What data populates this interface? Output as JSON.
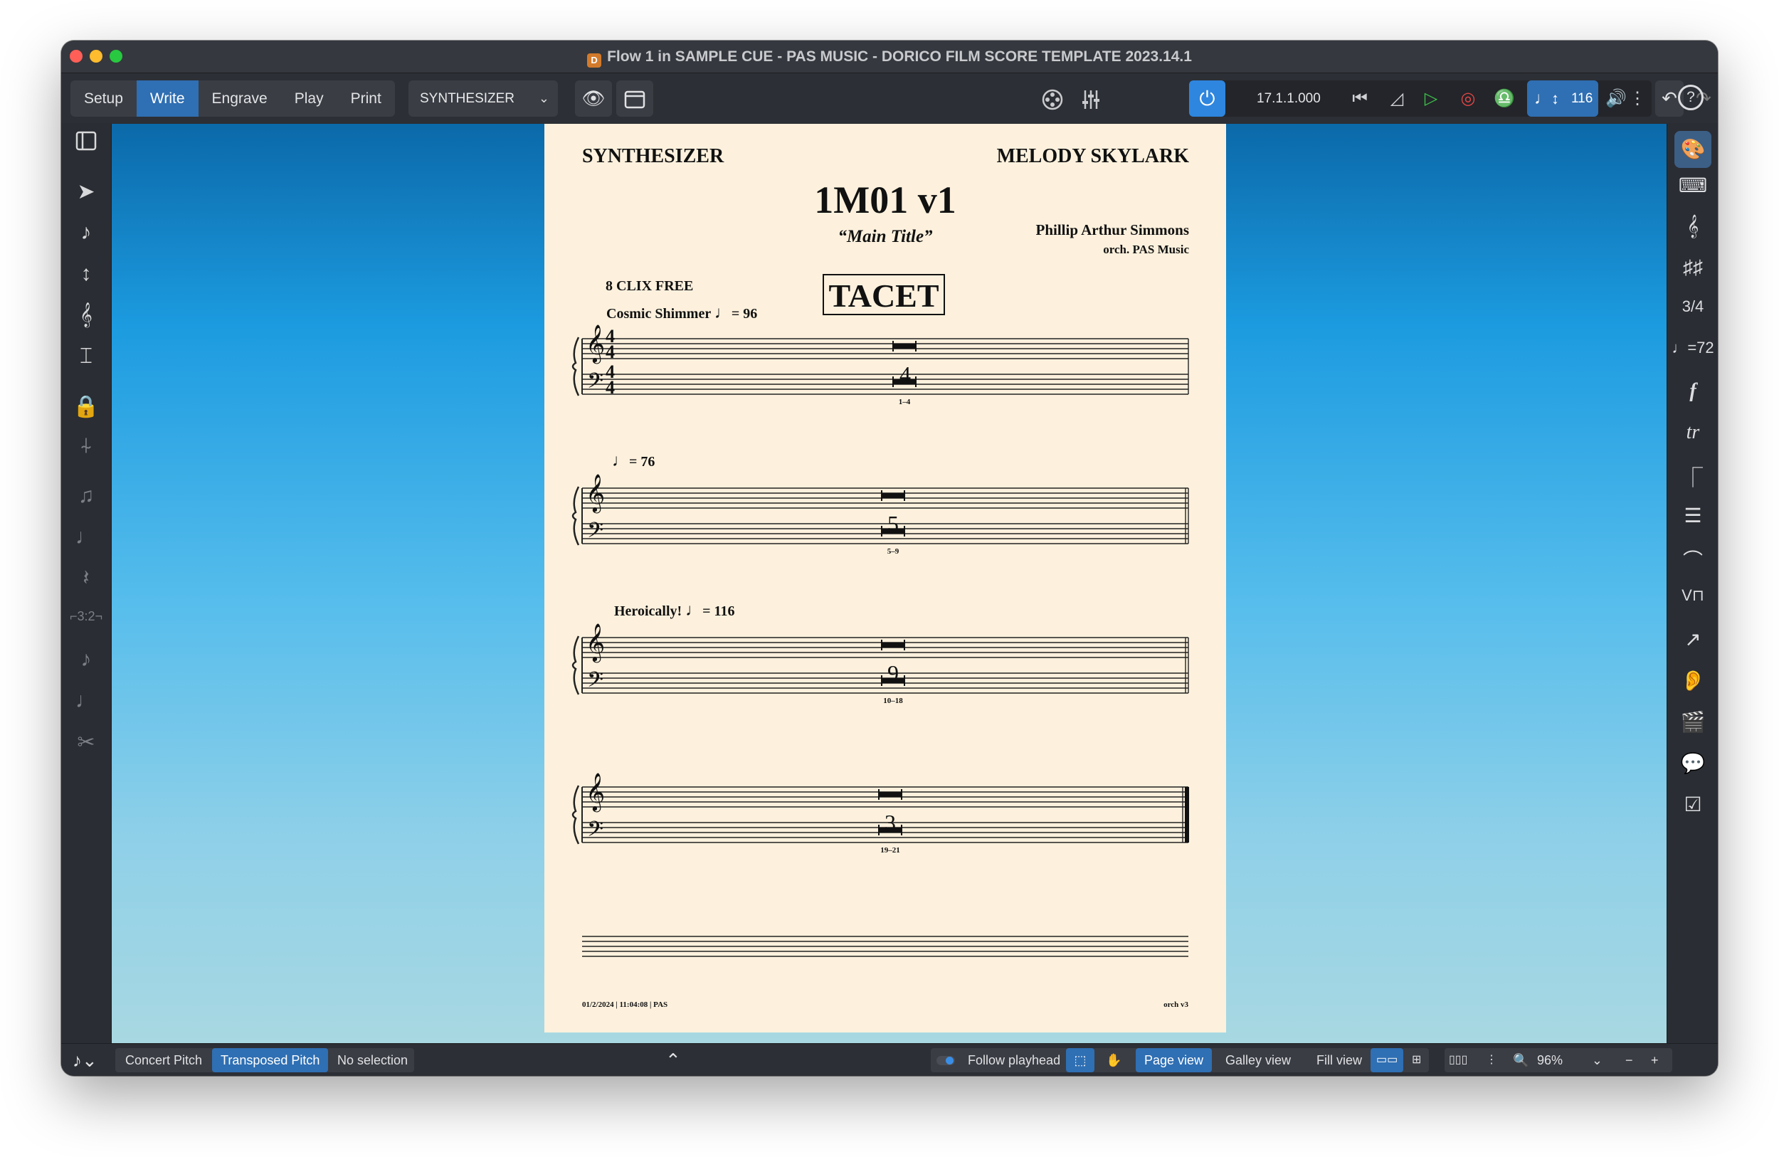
{
  "window": {
    "title": "Flow 1 in SAMPLE CUE - PAS MUSIC - DORICO FILM SCORE TEMPLATE 2023.14.1",
    "app_icon": "D",
    "colors": {
      "close": "#ff5f57",
      "minimize": "#febc2e",
      "zoom": "#28c840",
      "accent": "#2f6fb3"
    }
  },
  "toolbar": {
    "modes": [
      "Setup",
      "Write",
      "Engrave",
      "Play",
      "Print"
    ],
    "active_mode": "Write",
    "layout_select": "SYNTHESIZER",
    "transport": {
      "time": "17.1.1.000",
      "tempo": "116"
    }
  },
  "score": {
    "instrument": "SYNTHESIZER",
    "player_name": "MELODY SKYLARK",
    "title": "1M01 v1",
    "subtitle": "“Main Title”",
    "composer": "Phillip Arthur Simmons",
    "orchestrator": "orch. PAS Music",
    "tacet": "TACET",
    "systems": [
      {
        "rehearsal": "8 CLIX FREE",
        "tempo_text": "Cosmic Shimmer",
        "tempo_value": "= 96",
        "rest_count": "4",
        "bar_range": "1–4",
        "time_sig": "4"
      },
      {
        "tempo_value": "= 76",
        "rest_count": "5",
        "bar_range": "5–9"
      },
      {
        "tempo_text": "Heroically!",
        "tempo_value": "= 116",
        "rest_count": "9",
        "bar_range": "10–18"
      },
      {
        "rest_count": "3",
        "bar_range": "19–21"
      }
    ],
    "footer_left": "01/2/2024 | 11:04:08 | PAS",
    "footer_right": "orch v3"
  },
  "statusbar": {
    "concert_pitch": "Concert Pitch",
    "transposed_pitch": "Transposed Pitch",
    "selection": "No selection",
    "follow_playhead": "Follow playhead",
    "page_view": "Page view",
    "galley_view": "Galley view",
    "fill_view": "Fill view",
    "zoom": "96%"
  }
}
